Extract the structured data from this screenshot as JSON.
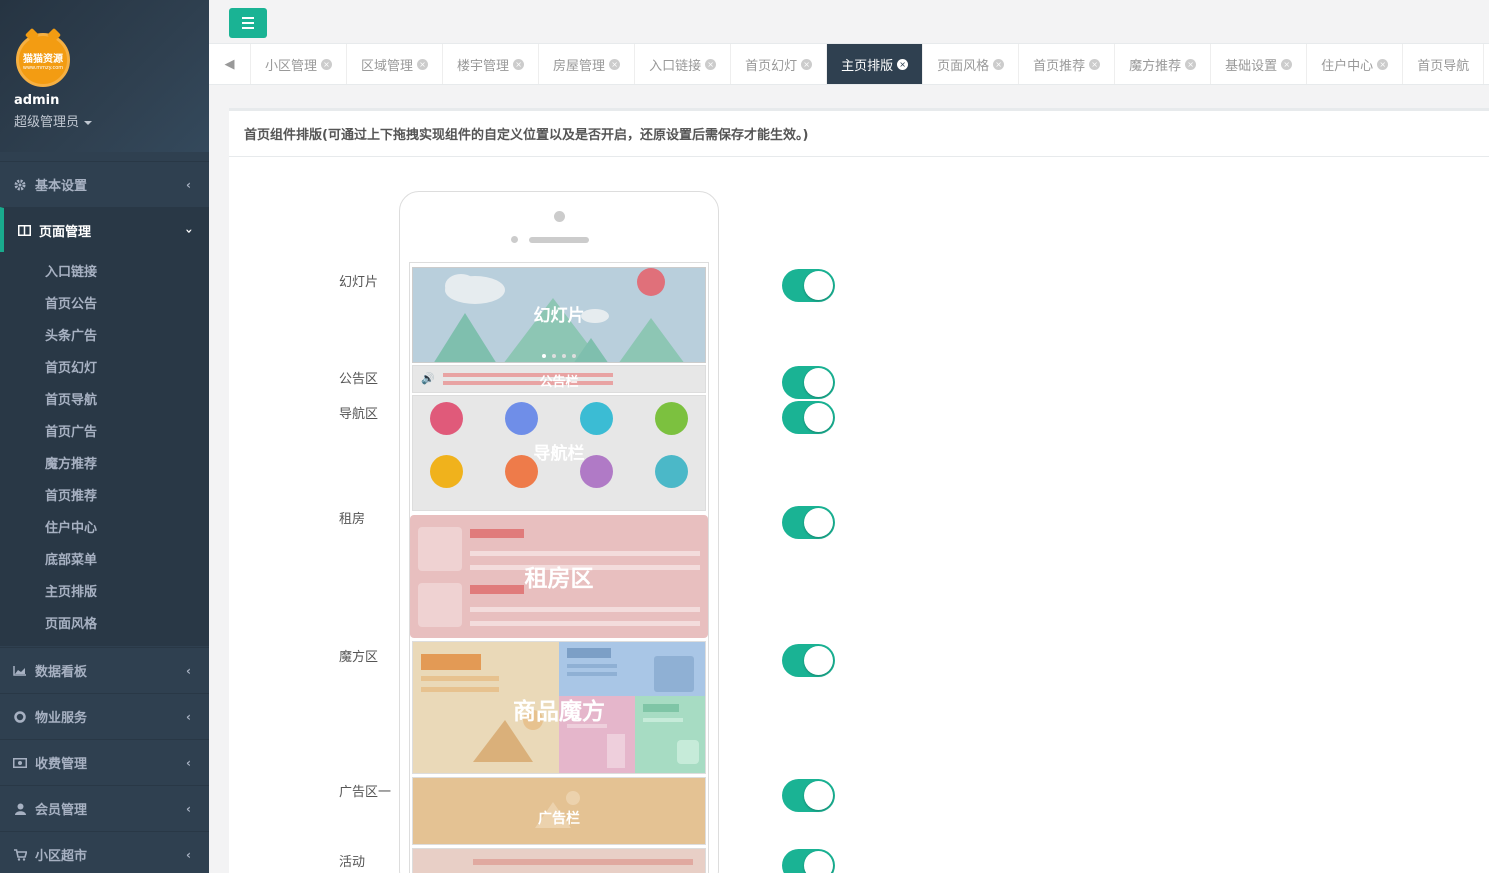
{
  "sidebar": {
    "logo_text": "猫猫资源",
    "logo_sub": "www.mmzy.com",
    "user_name": "admin",
    "user_role": "超级管理员",
    "menu": [
      {
        "label": "基本设置",
        "icon": "gear-icon"
      },
      {
        "label": "页面管理",
        "icon": "columns-icon"
      },
      {
        "label": "数据看板",
        "icon": "area-chart-icon"
      },
      {
        "label": "物业服务",
        "icon": "life-ring-icon"
      },
      {
        "label": "收费管理",
        "icon": "money-icon"
      },
      {
        "label": "会员管理",
        "icon": "user-icon"
      },
      {
        "label": "小区超市",
        "icon": "cart-icon"
      }
    ],
    "submenu": [
      "入口链接",
      "首页公告",
      "头条广告",
      "首页幻灯",
      "首页导航",
      "首页广告",
      "魔方推荐",
      "首页推荐",
      "住户中心",
      "底部菜单",
      "主页排版",
      "页面风格"
    ]
  },
  "tabs": [
    "小区管理",
    "区域管理",
    "楼宇管理",
    "房屋管理",
    "入口链接",
    "首页幻灯",
    "主页排版",
    "页面风格",
    "首页推荐",
    "魔方推荐",
    "基础设置",
    "住户中心",
    "首页导航"
  ],
  "active_tab": "主页排版",
  "panel": {
    "title": "首页组件排版(可通过上下拖拽实现组件的自定义位置以及是否开启，还原设置后需保存才能生效。)"
  },
  "components": [
    {
      "label": "幻灯片",
      "enabled": true
    },
    {
      "label": "公告区",
      "enabled": true
    },
    {
      "label": "导航区",
      "enabled": true
    },
    {
      "label": "租房",
      "enabled": true
    },
    {
      "label": "魔方区",
      "enabled": true
    },
    {
      "label": "广告区一",
      "enabled": true
    },
    {
      "label": "活动",
      "enabled": true
    }
  ],
  "preview": {
    "slide": "幻灯片",
    "notice": "公告栏",
    "nav": "导航栏",
    "rent": "租房区",
    "cube": "商品魔方",
    "ad": "广告栏"
  },
  "colors": {
    "accent": "#1ab394",
    "sidebar": "#2f4050"
  }
}
